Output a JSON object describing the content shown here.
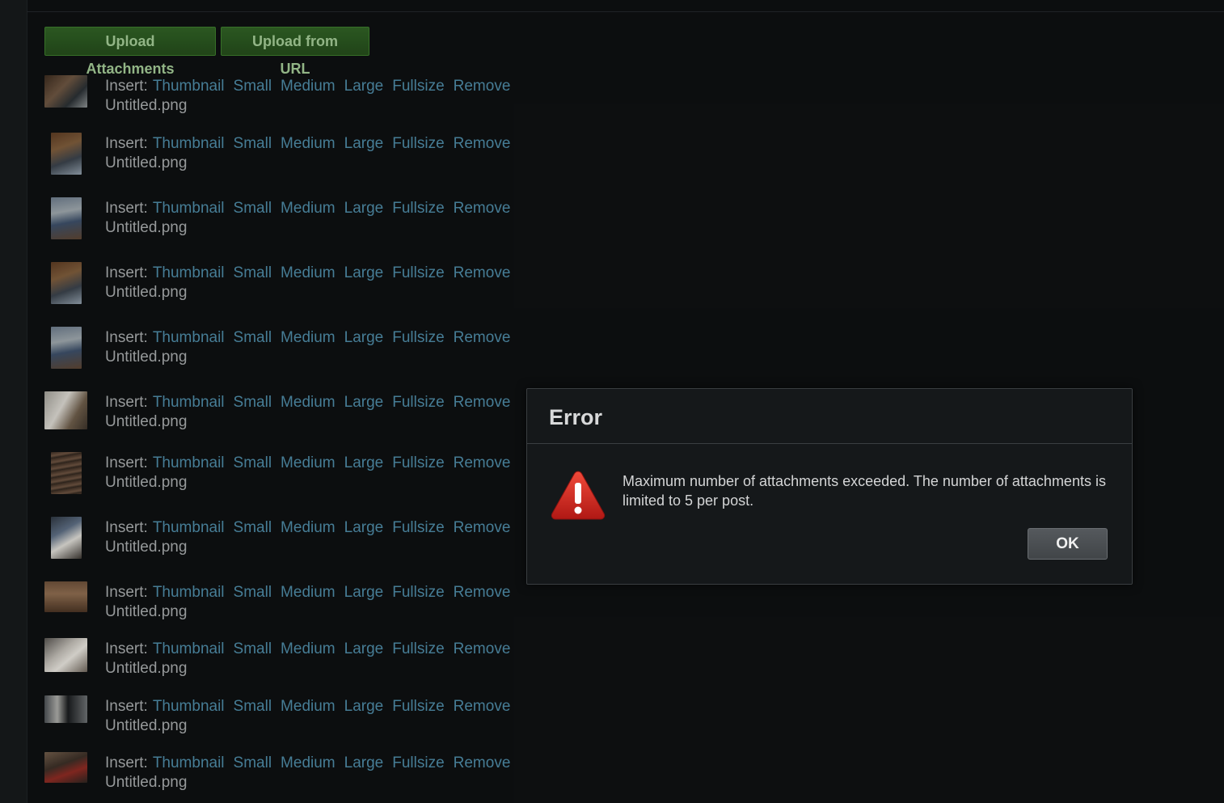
{
  "toolbar": {
    "upload_attachments_label": "Upload Attachments",
    "upload_url_label": "Upload from URL"
  },
  "attachment_actions": {
    "insert_label": "Insert:",
    "thumbnail": "Thumbnail",
    "small": "Small",
    "medium": "Medium",
    "large": "Large",
    "fullsize": "Fullsize",
    "remove": "Remove"
  },
  "attachments": [
    {
      "filename": "Untitled.png"
    },
    {
      "filename": "Untitled.png"
    },
    {
      "filename": "Untitled.png"
    },
    {
      "filename": "Untitled.png"
    },
    {
      "filename": "Untitled.png"
    },
    {
      "filename": "Untitled.png"
    },
    {
      "filename": "Untitled.png"
    },
    {
      "filename": "Untitled.png"
    },
    {
      "filename": "Untitled.png"
    },
    {
      "filename": "Untitled.png"
    },
    {
      "filename": "Untitled.png"
    },
    {
      "filename": "Untitled.png"
    }
  ],
  "dialog": {
    "title": "Error",
    "message": "Maximum number of attachments exceeded. The number of attachments is limited to 5 per post.",
    "ok_label": "OK",
    "icon": "warning-icon"
  },
  "colors": {
    "link": "#4d88a3",
    "upload_button": "#2f5f24",
    "background": "#0e1011"
  }
}
